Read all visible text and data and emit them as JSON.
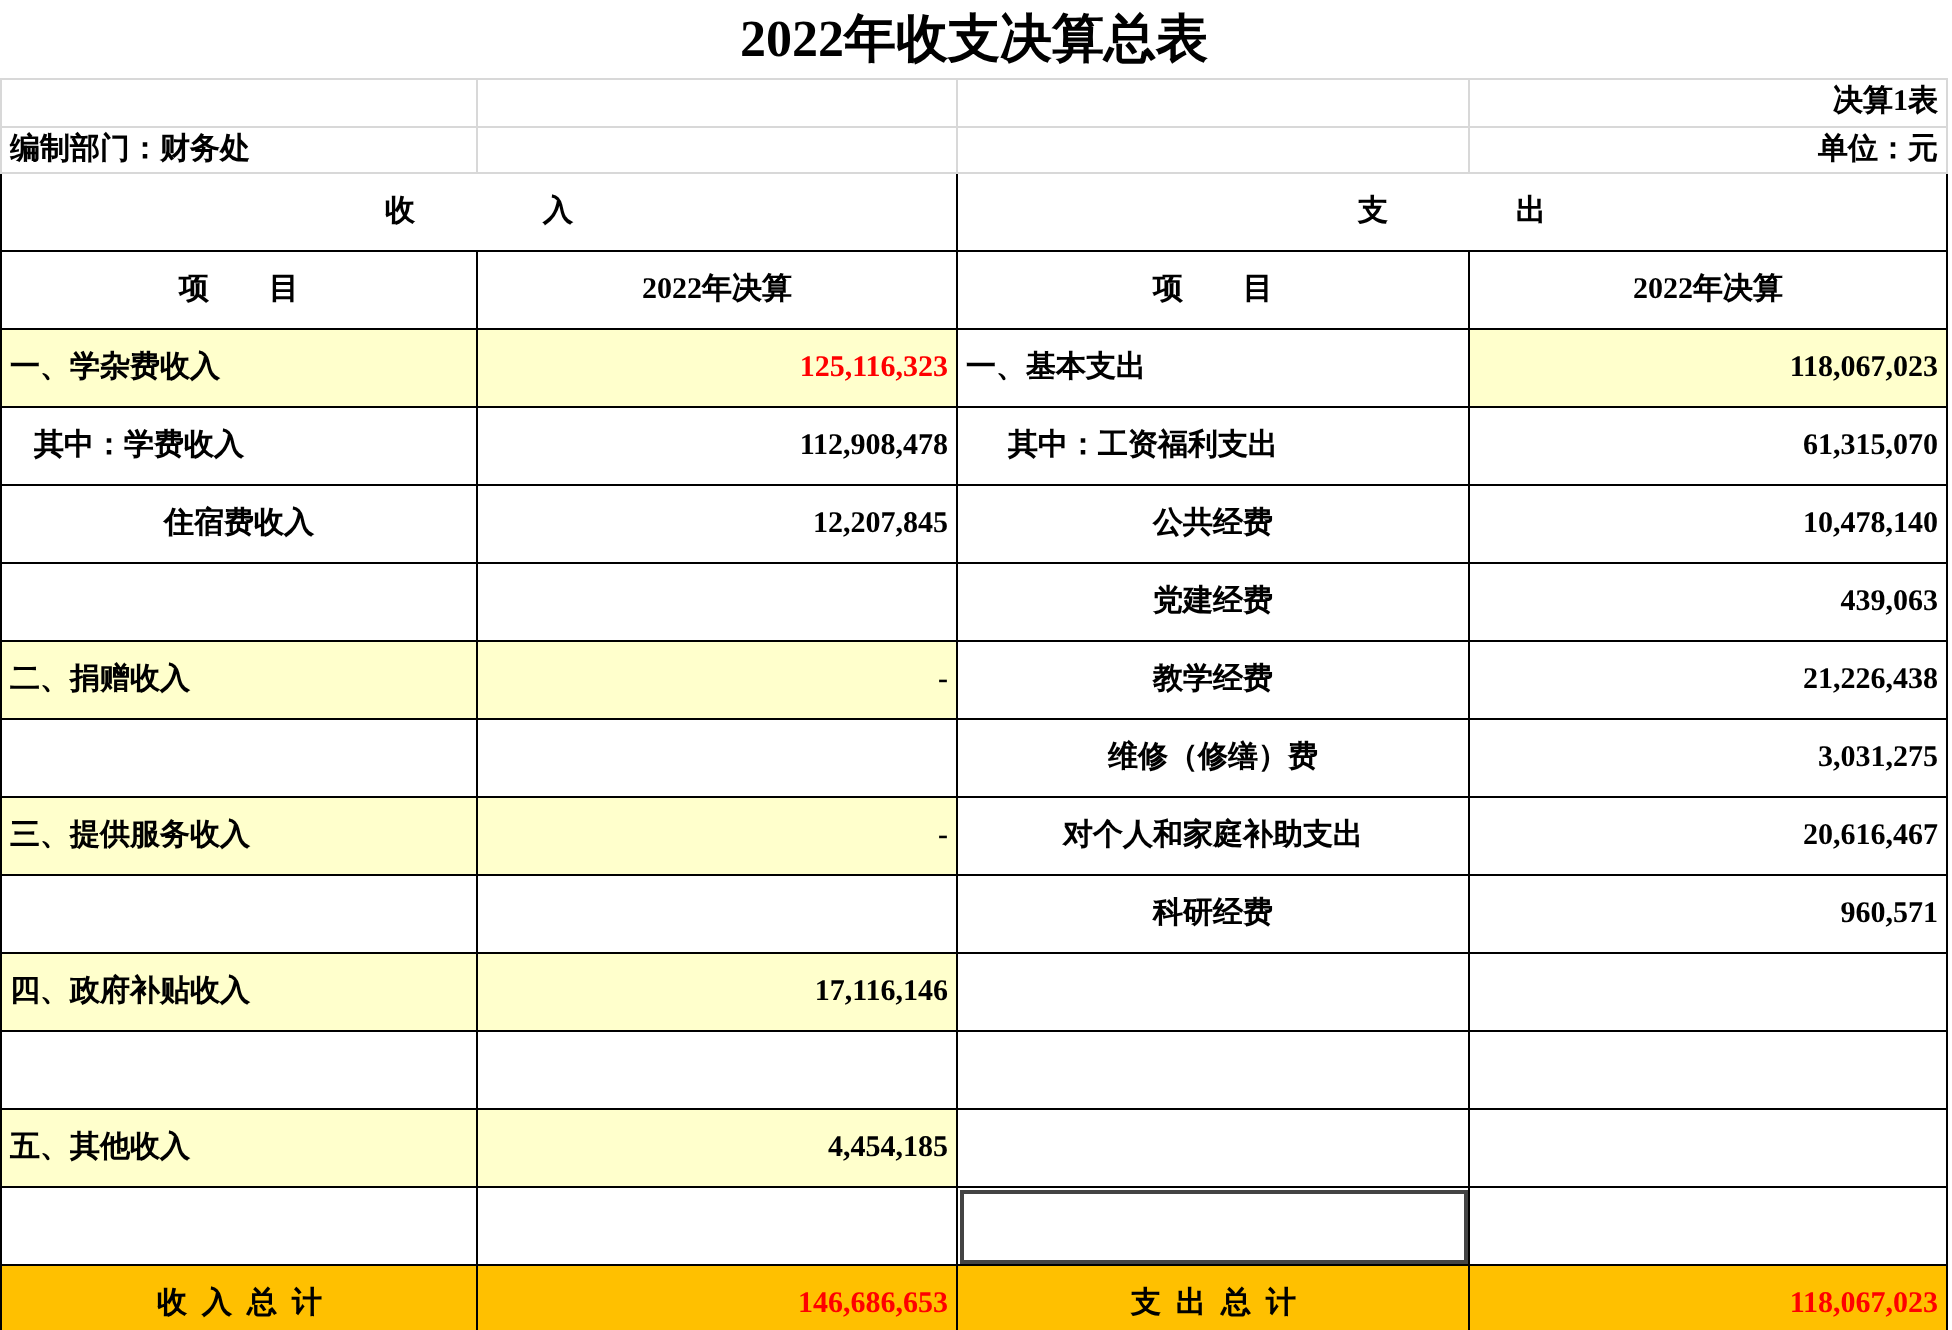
{
  "title": "2022年收支决算总表",
  "table_no": "决算1表",
  "department": "编制部门：财务处",
  "unit": "单位：元",
  "section_headers": [
    "收                 入",
    "支                 出"
  ],
  "column_headers": [
    "项        目",
    "2022年决算",
    "项        目",
    "2022年决算"
  ],
  "rows": [
    {
      "income": {
        "kind": "category",
        "label": "一、学杂费收入",
        "value": "125,116,323",
        "emphasis": true
      },
      "expense": {
        "kind": "category",
        "label": "一、基本支出",
        "value": "118,067,023",
        "emphasis": false,
        "selected": false
      }
    },
    {
      "income": {
        "kind": "sub",
        "label": "其中：学费收入",
        "value": "112,908,478",
        "emphasis": false
      },
      "expense": {
        "kind": "sub",
        "label": "其中：工资福利支出",
        "value": "61,315,070",
        "emphasis": false,
        "selected": false
      }
    },
    {
      "income": {
        "kind": "detail",
        "label": "住宿费收入",
        "value": "12,207,845",
        "emphasis": false
      },
      "expense": {
        "kind": "detail",
        "label": "公共经费",
        "value": "10,478,140",
        "emphasis": false,
        "selected": false
      }
    },
    {
      "income": {
        "kind": "blank"
      },
      "expense": {
        "kind": "detail",
        "label": "党建经费",
        "value": "439,063",
        "emphasis": false,
        "selected": false
      }
    },
    {
      "income": {
        "kind": "category",
        "label": "二、捐赠收入",
        "value": "-",
        "emphasis": false
      },
      "expense": {
        "kind": "detail",
        "label": "教学经费",
        "value": "21,226,438",
        "emphasis": false,
        "selected": false
      }
    },
    {
      "income": {
        "kind": "blank"
      },
      "expense": {
        "kind": "detail",
        "label": "维修（修缮）费",
        "value": "3,031,275",
        "emphasis": false,
        "selected": false
      }
    },
    {
      "income": {
        "kind": "category",
        "label": "三、提供服务收入",
        "value": "-",
        "emphasis": false
      },
      "expense": {
        "kind": "detail",
        "label": "对个人和家庭补助支出",
        "value": "20,616,467",
        "emphasis": false,
        "selected": false
      }
    },
    {
      "income": {
        "kind": "blank"
      },
      "expense": {
        "kind": "detail",
        "label": "科研经费",
        "value": "960,571",
        "emphasis": false,
        "selected": false
      }
    },
    {
      "income": {
        "kind": "category",
        "label": "四、政府补贴收入",
        "value": "17,116,146",
        "emphasis": false
      },
      "expense": {
        "kind": "blank",
        "selected": false
      }
    },
    {
      "income": {
        "kind": "blank"
      },
      "expense": {
        "kind": "blank",
        "selected": false
      }
    },
    {
      "income": {
        "kind": "category",
        "label": "五、其他收入",
        "value": "4,454,185",
        "emphasis": false
      },
      "expense": {
        "kind": "blank",
        "selected": false
      }
    },
    {
      "income": {
        "kind": "blank"
      },
      "expense": {
        "kind": "blank",
        "selected": true
      }
    }
  ],
  "totals": {
    "income_label": "收  入  总  计",
    "income_value": "146,686,653",
    "income_emphasis": true,
    "expense_label": "支  出  总  计",
    "expense_value": "118,067,023",
    "expense_emphasis": true
  }
}
